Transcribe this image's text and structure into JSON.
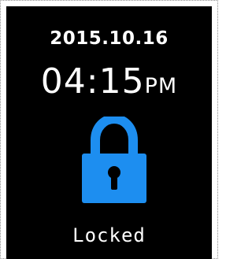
{
  "lockscreen": {
    "date": "2015.10.16",
    "time": "04:15",
    "ampm": "PM",
    "status": "Locked",
    "lock_icon": "padlock-icon"
  },
  "colors": {
    "background": "#000000",
    "text": "#ffffff",
    "lock": "#1d8ef0"
  }
}
